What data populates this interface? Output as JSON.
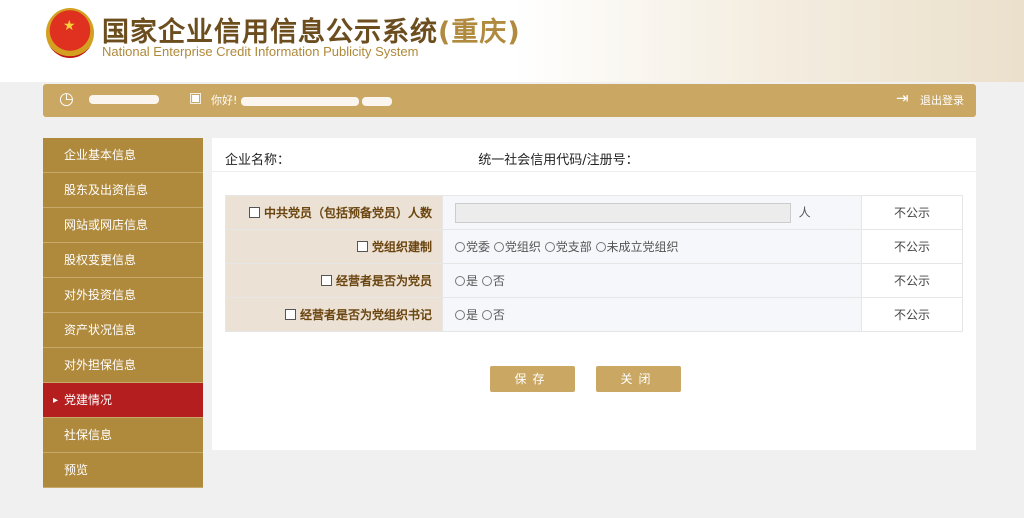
{
  "header": {
    "title": "国家企业信用信息公示系统",
    "region": "(重庆)",
    "subtitle": "National Enterprise Credit Information Publicity System"
  },
  "bar": {
    "greeting": "你好!",
    "logout": "退出登录"
  },
  "sidebar": {
    "items": [
      {
        "label": "企业基本信息"
      },
      {
        "label": "股东及出资信息"
      },
      {
        "label": "网站或网店信息"
      },
      {
        "label": "股权变更信息"
      },
      {
        "label": "对外投资信息"
      },
      {
        "label": "资产状况信息"
      },
      {
        "label": "对外担保信息"
      },
      {
        "label": "党建情况",
        "active": true
      },
      {
        "label": "社保信息"
      },
      {
        "label": "预览"
      }
    ]
  },
  "main": {
    "company_label": "企业名称：",
    "code_label": "统一社会信用代码/注册号：",
    "rows": [
      {
        "label": "中共党员（包括预备党员）人数",
        "unit": "人",
        "public": "不公示"
      },
      {
        "label": "党组织建制",
        "options": [
          "党委",
          "党组织",
          "党支部",
          "未成立党组织"
        ],
        "public": "不公示"
      },
      {
        "label": "经营者是否为党员",
        "options": [
          "是",
          "否"
        ],
        "public": "不公示"
      },
      {
        "label": "经营者是否为党组织书记",
        "options": [
          "是",
          "否"
        ],
        "public": "不公示"
      }
    ],
    "save": "保存",
    "close": "关闭"
  },
  "colors": {
    "gold": "#caa762",
    "active": "#b41e1e"
  }
}
